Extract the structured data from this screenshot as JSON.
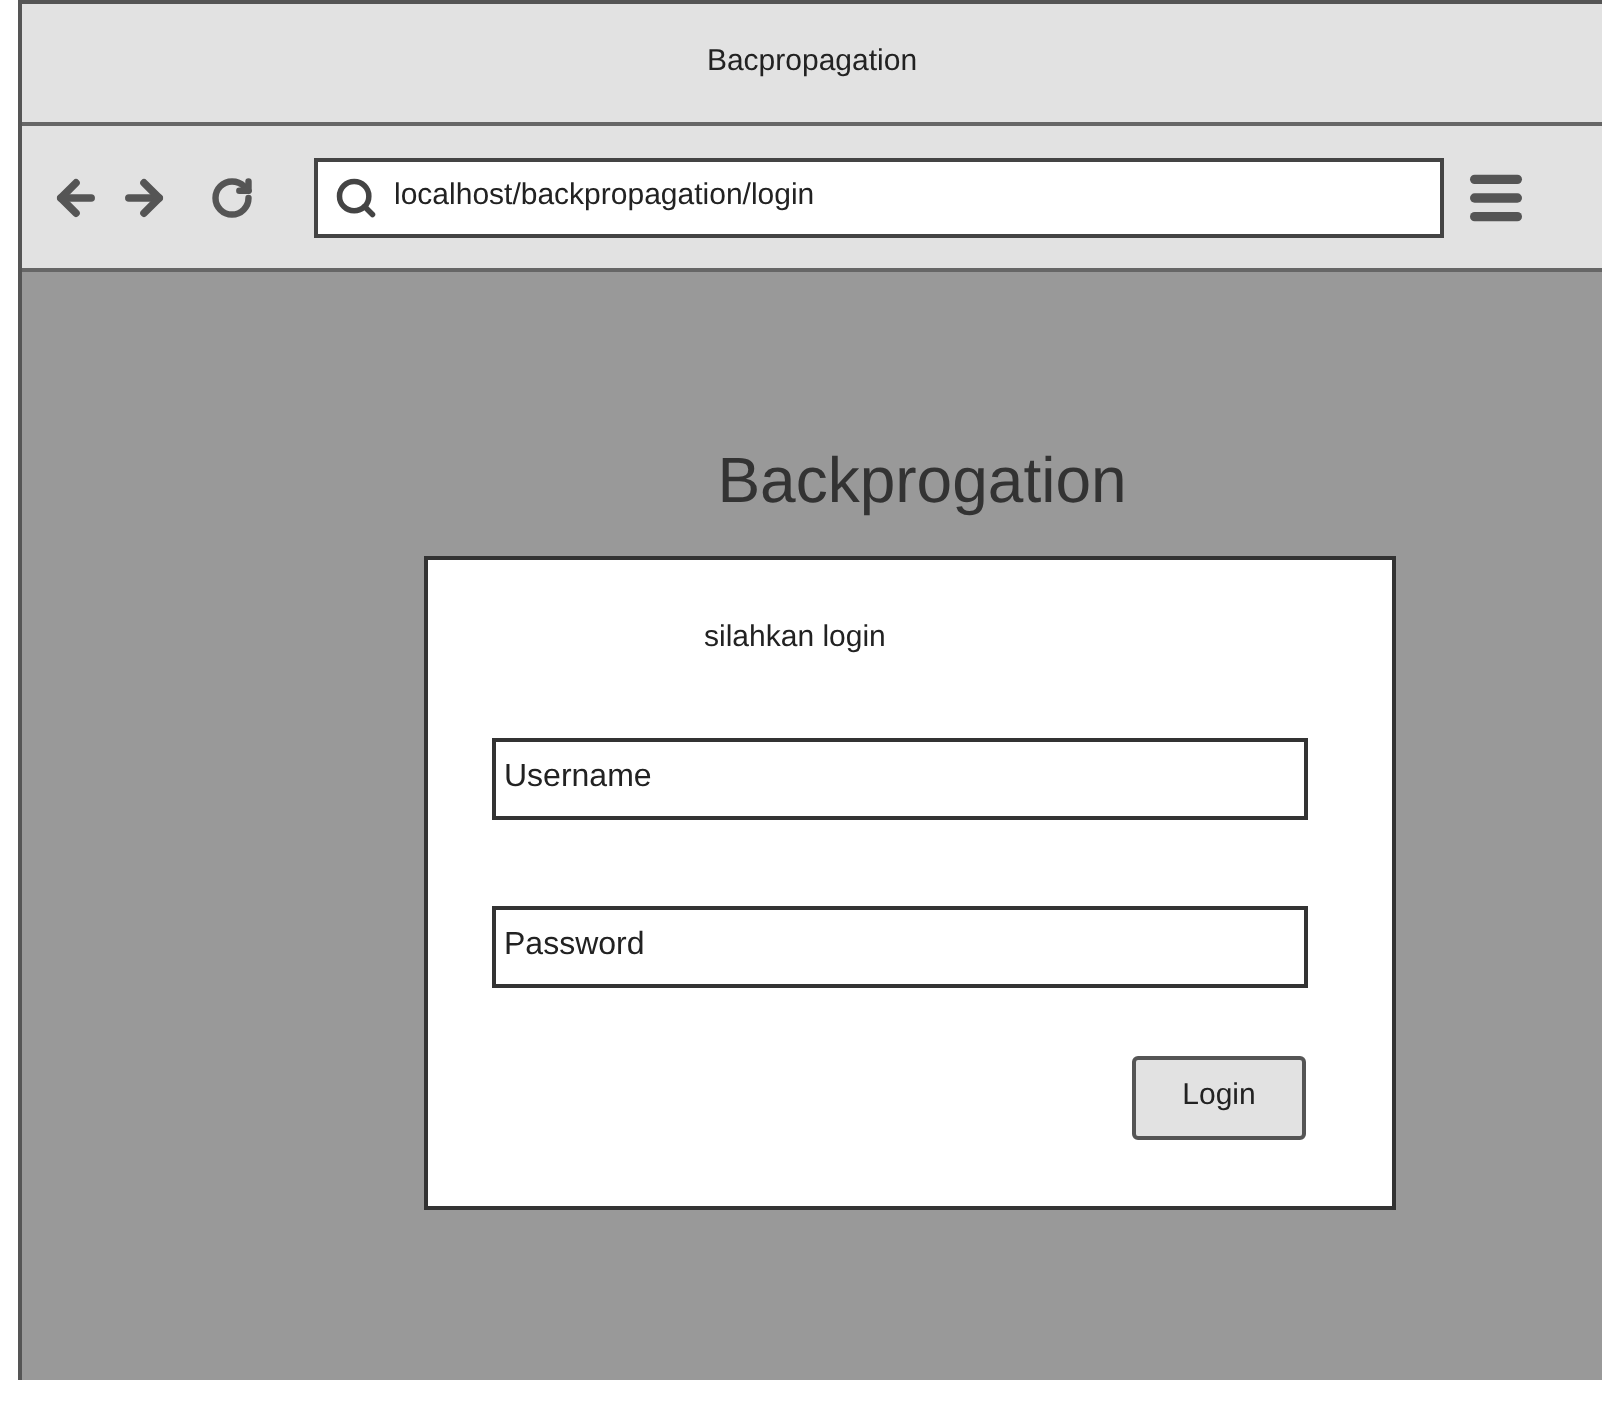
{
  "window": {
    "title": "Bacpropagation"
  },
  "address_bar": {
    "url": "localhost/backpropagation/login"
  },
  "page": {
    "heading": "Backprogation",
    "login_card": {
      "subtitle": "silahkan login",
      "fields": [
        {
          "placeholder": "Username"
        },
        {
          "placeholder": "Password"
        }
      ],
      "button": "Login"
    }
  }
}
